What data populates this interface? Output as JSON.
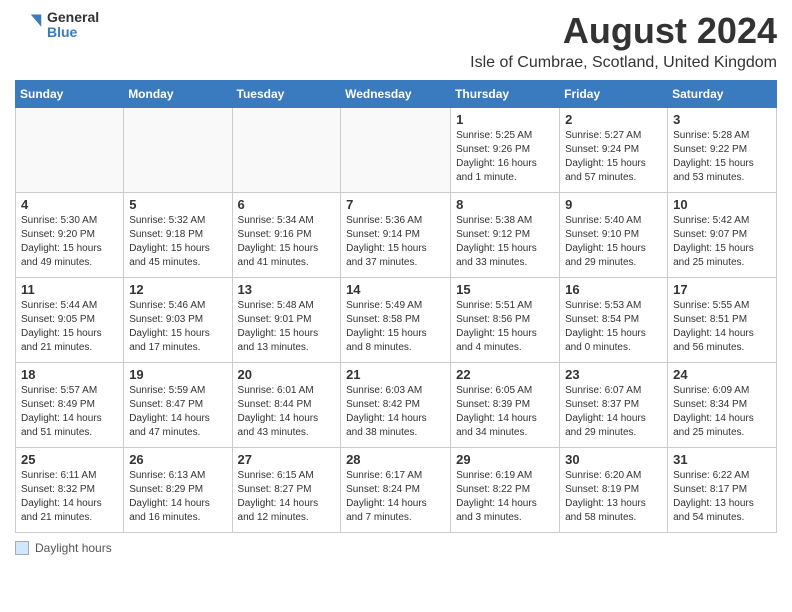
{
  "logo": {
    "general": "General",
    "blue": "Blue"
  },
  "title": "August 2024",
  "subtitle": "Isle of Cumbrae, Scotland, United Kingdom",
  "headers": [
    "Sunday",
    "Monday",
    "Tuesday",
    "Wednesday",
    "Thursday",
    "Friday",
    "Saturday"
  ],
  "legend_label": "Daylight hours",
  "weeks": [
    [
      {
        "day": "",
        "detail": ""
      },
      {
        "day": "",
        "detail": ""
      },
      {
        "day": "",
        "detail": ""
      },
      {
        "day": "",
        "detail": ""
      },
      {
        "day": "1",
        "detail": "Sunrise: 5:25 AM\nSunset: 9:26 PM\nDaylight: 16 hours and 1 minute."
      },
      {
        "day": "2",
        "detail": "Sunrise: 5:27 AM\nSunset: 9:24 PM\nDaylight: 15 hours and 57 minutes."
      },
      {
        "day": "3",
        "detail": "Sunrise: 5:28 AM\nSunset: 9:22 PM\nDaylight: 15 hours and 53 minutes."
      }
    ],
    [
      {
        "day": "4",
        "detail": "Sunrise: 5:30 AM\nSunset: 9:20 PM\nDaylight: 15 hours and 49 minutes."
      },
      {
        "day": "5",
        "detail": "Sunrise: 5:32 AM\nSunset: 9:18 PM\nDaylight: 15 hours and 45 minutes."
      },
      {
        "day": "6",
        "detail": "Sunrise: 5:34 AM\nSunset: 9:16 PM\nDaylight: 15 hours and 41 minutes."
      },
      {
        "day": "7",
        "detail": "Sunrise: 5:36 AM\nSunset: 9:14 PM\nDaylight: 15 hours and 37 minutes."
      },
      {
        "day": "8",
        "detail": "Sunrise: 5:38 AM\nSunset: 9:12 PM\nDaylight: 15 hours and 33 minutes."
      },
      {
        "day": "9",
        "detail": "Sunrise: 5:40 AM\nSunset: 9:10 PM\nDaylight: 15 hours and 29 minutes."
      },
      {
        "day": "10",
        "detail": "Sunrise: 5:42 AM\nSunset: 9:07 PM\nDaylight: 15 hours and 25 minutes."
      }
    ],
    [
      {
        "day": "11",
        "detail": "Sunrise: 5:44 AM\nSunset: 9:05 PM\nDaylight: 15 hours and 21 minutes."
      },
      {
        "day": "12",
        "detail": "Sunrise: 5:46 AM\nSunset: 9:03 PM\nDaylight: 15 hours and 17 minutes."
      },
      {
        "day": "13",
        "detail": "Sunrise: 5:48 AM\nSunset: 9:01 PM\nDaylight: 15 hours and 13 minutes."
      },
      {
        "day": "14",
        "detail": "Sunrise: 5:49 AM\nSunset: 8:58 PM\nDaylight: 15 hours and 8 minutes."
      },
      {
        "day": "15",
        "detail": "Sunrise: 5:51 AM\nSunset: 8:56 PM\nDaylight: 15 hours and 4 minutes."
      },
      {
        "day": "16",
        "detail": "Sunrise: 5:53 AM\nSunset: 8:54 PM\nDaylight: 15 hours and 0 minutes."
      },
      {
        "day": "17",
        "detail": "Sunrise: 5:55 AM\nSunset: 8:51 PM\nDaylight: 14 hours and 56 minutes."
      }
    ],
    [
      {
        "day": "18",
        "detail": "Sunrise: 5:57 AM\nSunset: 8:49 PM\nDaylight: 14 hours and 51 minutes."
      },
      {
        "day": "19",
        "detail": "Sunrise: 5:59 AM\nSunset: 8:47 PM\nDaylight: 14 hours and 47 minutes."
      },
      {
        "day": "20",
        "detail": "Sunrise: 6:01 AM\nSunset: 8:44 PM\nDaylight: 14 hours and 43 minutes."
      },
      {
        "day": "21",
        "detail": "Sunrise: 6:03 AM\nSunset: 8:42 PM\nDaylight: 14 hours and 38 minutes."
      },
      {
        "day": "22",
        "detail": "Sunrise: 6:05 AM\nSunset: 8:39 PM\nDaylight: 14 hours and 34 minutes."
      },
      {
        "day": "23",
        "detail": "Sunrise: 6:07 AM\nSunset: 8:37 PM\nDaylight: 14 hours and 29 minutes."
      },
      {
        "day": "24",
        "detail": "Sunrise: 6:09 AM\nSunset: 8:34 PM\nDaylight: 14 hours and 25 minutes."
      }
    ],
    [
      {
        "day": "25",
        "detail": "Sunrise: 6:11 AM\nSunset: 8:32 PM\nDaylight: 14 hours and 21 minutes."
      },
      {
        "day": "26",
        "detail": "Sunrise: 6:13 AM\nSunset: 8:29 PM\nDaylight: 14 hours and 16 minutes."
      },
      {
        "day": "27",
        "detail": "Sunrise: 6:15 AM\nSunset: 8:27 PM\nDaylight: 14 hours and 12 minutes."
      },
      {
        "day": "28",
        "detail": "Sunrise: 6:17 AM\nSunset: 8:24 PM\nDaylight: 14 hours and 7 minutes."
      },
      {
        "day": "29",
        "detail": "Sunrise: 6:19 AM\nSunset: 8:22 PM\nDaylight: 14 hours and 3 minutes."
      },
      {
        "day": "30",
        "detail": "Sunrise: 6:20 AM\nSunset: 8:19 PM\nDaylight: 13 hours and 58 minutes."
      },
      {
        "day": "31",
        "detail": "Sunrise: 6:22 AM\nSunset: 8:17 PM\nDaylight: 13 hours and 54 minutes."
      }
    ]
  ]
}
